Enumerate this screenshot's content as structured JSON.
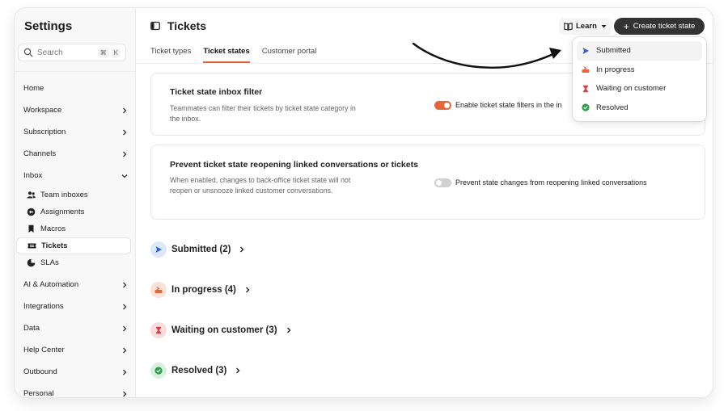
{
  "sidebar": {
    "title": "Settings",
    "search": {
      "placeholder": "Search",
      "shortcut": [
        "⌘",
        "K"
      ]
    },
    "items": [
      {
        "label": "Home",
        "has_chevron": false
      },
      {
        "label": "Workspace",
        "has_chevron": true
      },
      {
        "label": "Subscription",
        "has_chevron": true
      },
      {
        "label": "Channels",
        "has_chevron": true
      },
      {
        "label": "Inbox",
        "has_chevron": true,
        "expanded": true
      }
    ],
    "inbox_children": [
      {
        "label": "Team inboxes",
        "icon": "team-icon"
      },
      {
        "label": "Assignments",
        "icon": "assignments-icon"
      },
      {
        "label": "Macros",
        "icon": "bookmark-icon"
      },
      {
        "label": "Tickets",
        "icon": "ticket-icon",
        "active": true
      },
      {
        "label": "SLAs",
        "icon": "pie-icon"
      }
    ],
    "items_after": [
      {
        "label": "AI & Automation"
      },
      {
        "label": "Integrations"
      },
      {
        "label": "Data"
      },
      {
        "label": "Help Center"
      },
      {
        "label": "Outbound"
      },
      {
        "label": "Personal"
      }
    ]
  },
  "header": {
    "title": "Tickets",
    "learn_label": "Learn",
    "create_label": "Create ticket state"
  },
  "tabs": [
    {
      "label": "Ticket types",
      "active": false
    },
    {
      "label": "Ticket states",
      "active": true
    },
    {
      "label": "Customer portal",
      "active": false
    }
  ],
  "cards": {
    "inbox_filter": {
      "title": "Ticket state inbox filter",
      "description": "Teammates can filter their tickets by ticket state category in the inbox.",
      "toggle_label": "Enable ticket state filters in the in",
      "toggle_on": true
    },
    "reopening": {
      "title": "Prevent ticket state reopening linked conversations or tickets",
      "description": "When enabled, changes to back-office ticket state will not reopen or unsnooze linked customer conversations.",
      "toggle_label": "Prevent state changes from reopening linked conversations",
      "toggle_on": false
    }
  },
  "groups": [
    {
      "label": "Submitted (2)",
      "icon": "submitted-icon",
      "bg": "#dbe7fb"
    },
    {
      "label": "In progress (4)",
      "icon": "in-progress-icon",
      "bg": "#fbe2d6"
    },
    {
      "label": "Waiting on customer (3)",
      "icon": "hourglass-icon",
      "bg": "#fbdcdc"
    },
    {
      "label": "Resolved (3)",
      "icon": "check-circle-icon",
      "bg": "#d7f1dc"
    }
  ],
  "menu": {
    "items": [
      {
        "label": "Submitted",
        "icon": "submitted-icon",
        "active": true
      },
      {
        "label": "In progress",
        "icon": "in-progress-icon"
      },
      {
        "label": "Waiting on customer",
        "icon": "hourglass-icon"
      },
      {
        "label": "Resolved",
        "icon": "check-circle-icon"
      }
    ]
  },
  "colors": {
    "accent": "#e4663a",
    "toggle_on": "#e4663a",
    "toggle_off": "#d0d0d0",
    "create_button_bg": "#333333",
    "submitted": "#2f5fd0",
    "in_progress": "#e4663a",
    "waiting": "#d64545",
    "resolved": "#2e9e48"
  }
}
